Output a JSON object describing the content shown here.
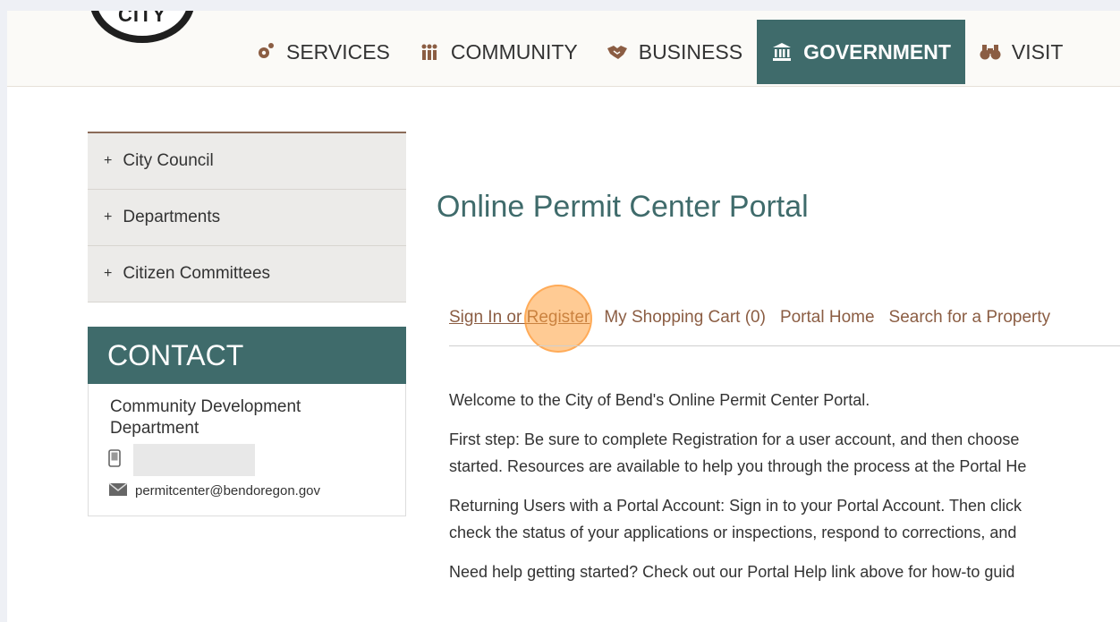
{
  "logo": {
    "text": "CITY"
  },
  "nav": {
    "items": [
      {
        "label": "SERVICES",
        "icon": "gears-icon"
      },
      {
        "label": "COMMUNITY",
        "icon": "people-icon"
      },
      {
        "label": "BUSINESS",
        "icon": "handshake-icon"
      },
      {
        "label": "GOVERNMENT",
        "icon": "capitol-icon",
        "active": true
      },
      {
        "label": "VISIT",
        "icon": "binoculars-icon"
      }
    ]
  },
  "sidebar": {
    "items": [
      {
        "label": "City Council"
      },
      {
        "label": "Departments"
      },
      {
        "label": "Citizen Committees"
      }
    ]
  },
  "contact": {
    "heading": "CONTACT",
    "department": "Community Development Department",
    "phone": "",
    "email": "permitcenter@bendoregon.gov"
  },
  "main": {
    "title": "Online Permit Center Portal",
    "portal_nav": {
      "sign_in": "Sign In or Register",
      "cart": "My Shopping Cart (0)",
      "home": "Portal Home",
      "search": "Search for a Property"
    },
    "paragraphs": [
      "Welcome to the City of Bend's Online Permit Center Portal.",
      "First step: Be sure to complete Registration for a user account, and then choose",
      "started. Resources are available to help you through the process at the Portal He",
      "Returning Users with a Portal Account: Sign in to your Portal Account. Then click",
      "check the status of your applications or inspections, respond to corrections, and",
      "Need help getting started? Check out our Portal Help link above for how-to guid"
    ]
  },
  "colors": {
    "teal": "#3f6b6b",
    "link_brown": "#8b5d43",
    "click_highlight": "#ffa03c"
  }
}
